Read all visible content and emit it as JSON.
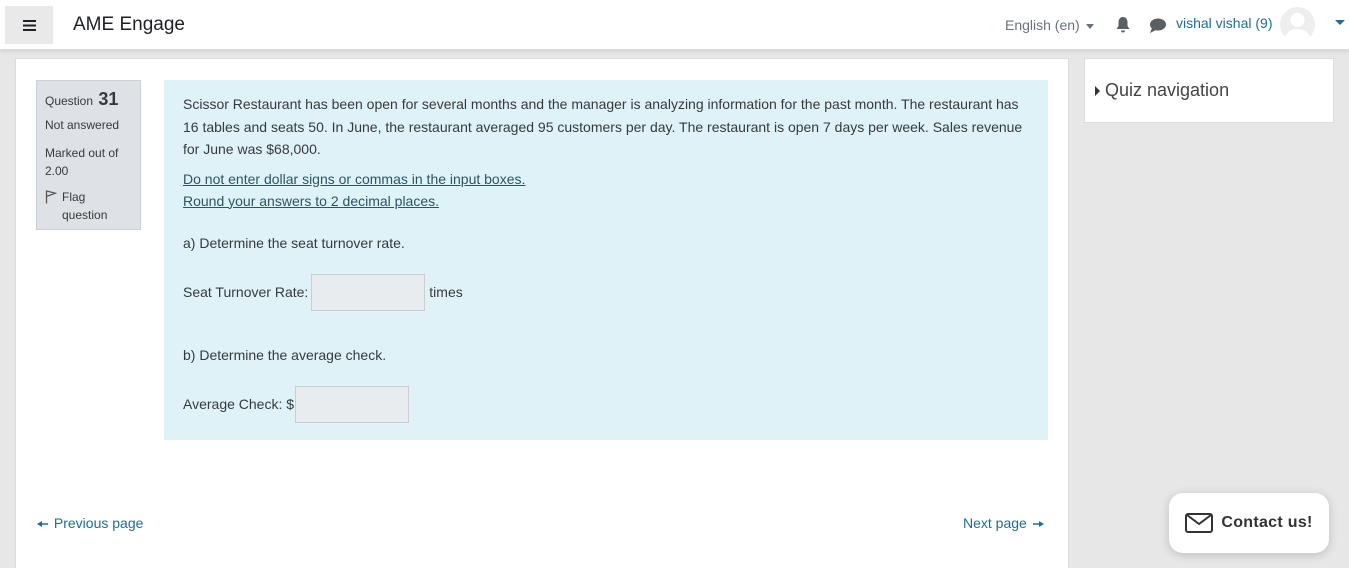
{
  "navbar": {
    "menu_icon": "hamburger-icon",
    "site_name": "AME Engage",
    "language": "English (en)",
    "notification_icon": "bell-icon",
    "messages_icon": "chat-bubble-icon",
    "user_name": "vishal vishal (9)",
    "avatar_icon": "user-avatar-icon"
  },
  "question_info": {
    "label": "Question",
    "number": "31",
    "state": "Not answered",
    "grade": "Marked out of 2.00",
    "flag_label": "Flag question",
    "flag_icon": "flag-outline-icon"
  },
  "question": {
    "text": "Scissor Restaurant has been open for several months and the manager is analyzing information for the past month. The restaurant has 16 tables and seats 50. In June, the restaurant averaged 95 customers per day. The restaurant is open 7 days per week. Sales revenue for June was $68,000.",
    "instruction_1": "Do not enter dollar signs or commas in the input boxes.",
    "instruction_2": "Round your answers to 2 decimal places.",
    "part_a": "a) Determine the seat turnover rate.",
    "part_a_label": "Seat Turnover Rate:",
    "part_a_value": "",
    "part_a_unit": "times",
    "part_b": "b) Determine the average check.",
    "part_b_label": "Average Check: $",
    "part_b_value": ""
  },
  "navigation": {
    "previous": "Previous page",
    "next": "Next page",
    "previous_icon": "arrow-left-icon",
    "next_icon": "arrow-right-icon"
  },
  "quiz_nav": {
    "title": "Quiz navigation"
  },
  "contact": {
    "label": "Contact us!",
    "icon": "envelope-icon"
  },
  "colors": {
    "accent": "#1f6e8c",
    "question_bg": "#def2f8",
    "info_bg": "#dee2e6",
    "page_bg": "#e7e7e7"
  }
}
